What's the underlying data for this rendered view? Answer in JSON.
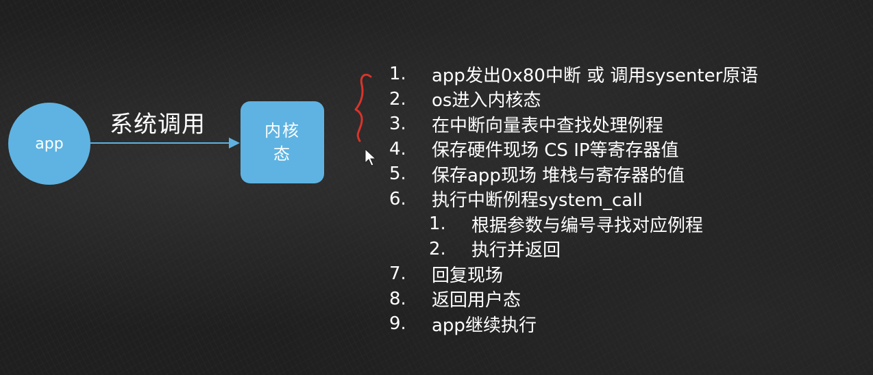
{
  "diagram": {
    "nodes": {
      "app": {
        "label": "app"
      },
      "kernel": {
        "label": "内核态"
      }
    },
    "edge": {
      "from": "app",
      "to": "kernel",
      "label": "系统调用"
    }
  },
  "steps": [
    {
      "num": "1.",
      "text": "app发出0x80中断 或 调用sysenter原语",
      "level": 0
    },
    {
      "num": "2.",
      "text": "os进入内核态",
      "level": 0
    },
    {
      "num": "3.",
      "text": "在中断向量表中查找处理例程",
      "level": 0
    },
    {
      "num": "4.",
      "text": "保存硬件现场 CS IP等寄存器值",
      "level": 0
    },
    {
      "num": "5.",
      "text": "保存app现场 堆栈与寄存器的值",
      "level": 0
    },
    {
      "num": "6.",
      "text": "执行中断例程system_call",
      "level": 0
    },
    {
      "num": "1.",
      "text": "根据参数与编号寻找对应例程",
      "level": 1
    },
    {
      "num": "2.",
      "text": "执行并返回",
      "level": 1
    },
    {
      "num": "7.",
      "text": "回复现场",
      "level": 0
    },
    {
      "num": "8.",
      "text": "返回用户态",
      "level": 0
    },
    {
      "num": "9.",
      "text": "app继续执行",
      "level": 0
    }
  ],
  "colors": {
    "node_fill": "#5eb3e2",
    "text": "#ffffff",
    "background": "#1f1f1f",
    "annotation": "#d9342b"
  }
}
